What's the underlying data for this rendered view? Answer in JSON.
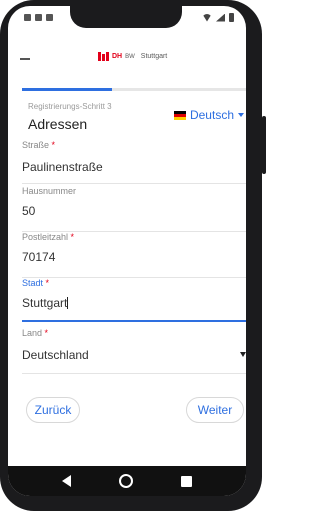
{
  "header": {
    "logo_dh": "DH",
    "logo_bw": "BW",
    "logo_city": "Stuttgart"
  },
  "progress": {
    "fraction": 0.4
  },
  "step_label": "Registrierungs-Schritt 3",
  "page_title": "Adressen",
  "language": {
    "selected": "Deutsch",
    "flag_colors": [
      "#000000",
      "#dd0000",
      "#ffce00"
    ]
  },
  "fields": {
    "street": {
      "label": "Straße",
      "required_mark": "*",
      "value": "Paulinenstraße"
    },
    "house_number": {
      "label": "Hausnummer",
      "value": "50"
    },
    "postal_code": {
      "label": "Postleitzahl",
      "required_mark": "*",
      "value": "70174"
    },
    "city": {
      "label": "Stadt",
      "required_mark": "*",
      "value": "Stuttgart"
    },
    "country": {
      "label": "Land",
      "required_mark": "*",
      "value": "Deutschland"
    }
  },
  "buttons": {
    "back": "Zurück",
    "next": "Weiter"
  },
  "colors": {
    "accent": "#2e6fe0",
    "brand": "#e2001a"
  }
}
